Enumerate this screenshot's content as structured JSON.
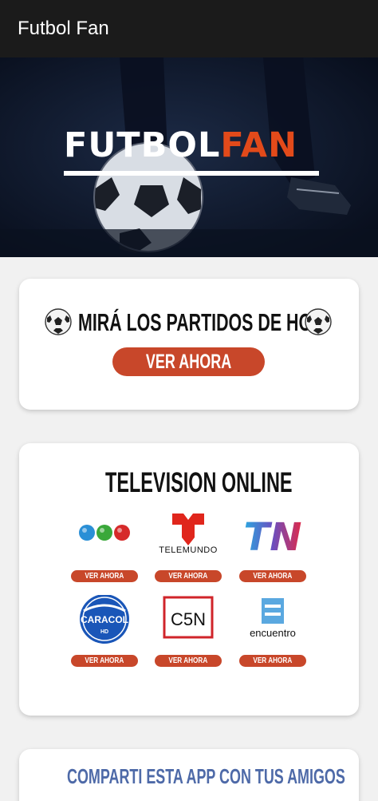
{
  "appbar": {
    "title": "Futbol Fan"
  },
  "hero": {
    "brand_part1": "FUTBOL",
    "brand_part2": "FAN"
  },
  "promo_card": {
    "heading": "MIRÁ LOS PARTIDOS DE HOY",
    "button_label": "VER AHORA",
    "icon": "soccer-ball-icon"
  },
  "tv_card": {
    "heading": "TELEVISION ONLINE",
    "channels": [
      {
        "name": "Telefe",
        "button_label": "VER AHORA"
      },
      {
        "name": "Telemundo",
        "logo_text": "TELEMUNDO",
        "button_label": "VER AHORA"
      },
      {
        "name": "TN",
        "logo_text": "TN",
        "button_label": "VER AHORA"
      },
      {
        "name": "Caracol",
        "logo_text": "CARACOL",
        "logo_subtext": "HD",
        "button_label": "VER AHORA"
      },
      {
        "name": "C5N",
        "logo_text": "C5N",
        "button_label": "VER AHORA"
      },
      {
        "name": "Encuentro",
        "logo_text": "encuentro",
        "button_label": "VER AHORA"
      }
    ]
  },
  "share_card": {
    "heading": "COMPARTI ESTA APP CON TUS AMIGOS"
  },
  "colors": {
    "accent": "#c8472a",
    "brand_orange": "#e24a1a",
    "appbar": "#1b1b1b",
    "share_text": "#4e6aa8"
  }
}
